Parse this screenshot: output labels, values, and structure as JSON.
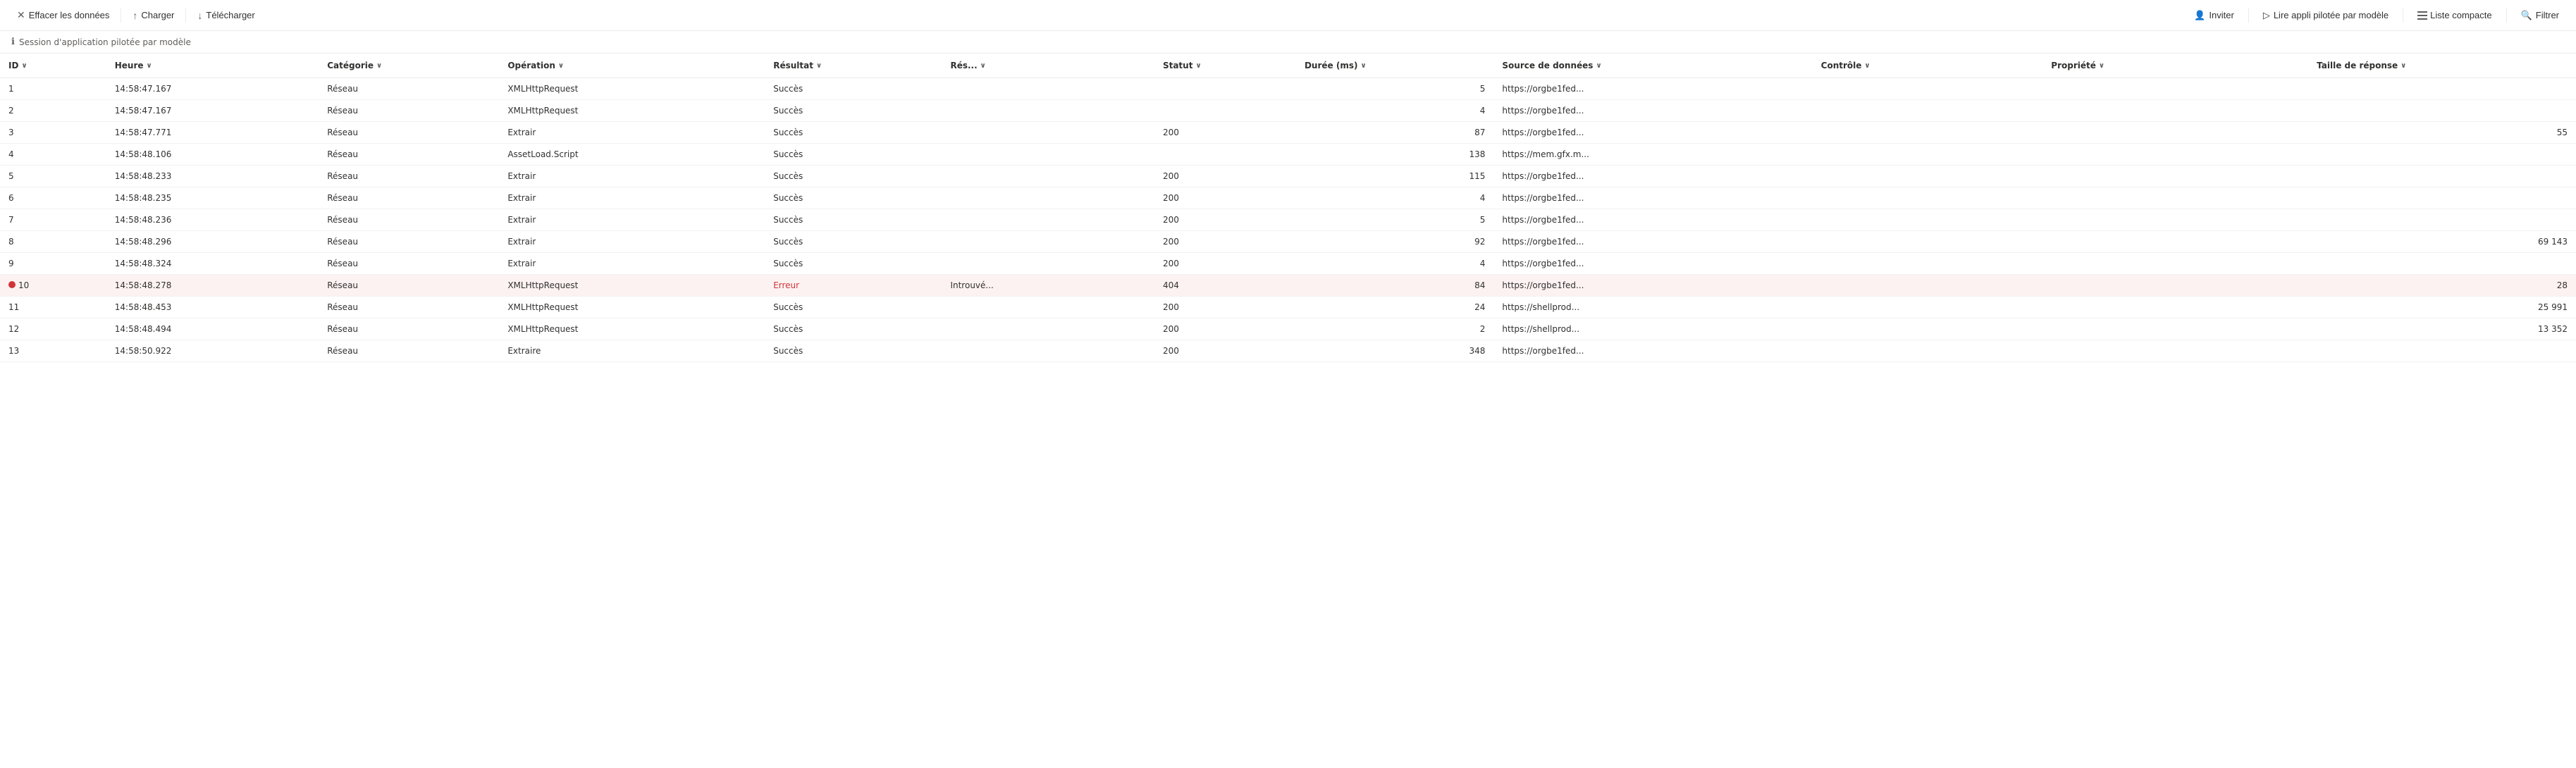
{
  "toolbar": {
    "clear_label": "Effacer les données",
    "load_label": "Charger",
    "download_label": "Télécharger",
    "invite_label": "Inviter",
    "read_app_label": "Lire appli pilotée par modèle",
    "liste_compacte_label": "Liste compacte",
    "filter_label": "Filtrer"
  },
  "session_bar": {
    "text": "Session d'application pilotée par modèle"
  },
  "table": {
    "columns": [
      {
        "id": "id",
        "label": "ID",
        "sortable": true
      },
      {
        "id": "heure",
        "label": "Heure",
        "sortable": true
      },
      {
        "id": "categorie",
        "label": "Catégorie",
        "sortable": true
      },
      {
        "id": "operation",
        "label": "Opération",
        "sortable": true
      },
      {
        "id": "resultat",
        "label": "Résultat",
        "sortable": true
      },
      {
        "id": "res",
        "label": "Rés...",
        "sortable": true
      },
      {
        "id": "statut",
        "label": "Statut",
        "sortable": true
      },
      {
        "id": "duree",
        "label": "Durée (ms)",
        "sortable": true
      },
      {
        "id": "source",
        "label": "Source de données",
        "sortable": true
      },
      {
        "id": "controle",
        "label": "Contrôle",
        "sortable": true
      },
      {
        "id": "propriete",
        "label": "Propriété",
        "sortable": true
      },
      {
        "id": "taille",
        "label": "Taille de réponse",
        "sortable": true
      }
    ],
    "rows": [
      {
        "id": 1,
        "heure": "14:58:47.167",
        "categorie": "Réseau",
        "operation": "XMLHttpRequest",
        "resultat": "Succès",
        "res": "",
        "statut": "",
        "duree": 5,
        "source": "https://orgbe1fed...",
        "controle": "",
        "propriete": "",
        "taille": "",
        "error": false
      },
      {
        "id": 2,
        "heure": "14:58:47.167",
        "categorie": "Réseau",
        "operation": "XMLHttpRequest",
        "resultat": "Succès",
        "res": "",
        "statut": "",
        "duree": 4,
        "source": "https://orgbe1fed...",
        "controle": "",
        "propriete": "",
        "taille": "",
        "error": false
      },
      {
        "id": 3,
        "heure": "14:58:47.771",
        "categorie": "Réseau",
        "operation": "Extrair",
        "resultat": "Succès",
        "res": "",
        "statut": 200,
        "duree": 87,
        "source": "https://orgbe1fed...",
        "controle": "",
        "propriete": "",
        "taille": 55,
        "error": false
      },
      {
        "id": 4,
        "heure": "14:58:48.106",
        "categorie": "Réseau",
        "operation": "AssetLoad.Script",
        "resultat": "Succès",
        "res": "",
        "statut": "",
        "duree": 138,
        "source": "https://mem.gfx.m...",
        "controle": "",
        "propriete": "",
        "taille": "",
        "error": false
      },
      {
        "id": 5,
        "heure": "14:58:48.233",
        "categorie": "Réseau",
        "operation": "Extrair",
        "resultat": "Succès",
        "res": "",
        "statut": 200,
        "duree": 115,
        "source": "https://orgbe1fed...",
        "controle": "",
        "propriete": "",
        "taille": "",
        "error": false
      },
      {
        "id": 6,
        "heure": "14:58:48.235",
        "categorie": "Réseau",
        "operation": "Extrair",
        "resultat": "Succès",
        "res": "",
        "statut": 200,
        "duree": 4,
        "source": "https://orgbe1fed...",
        "controle": "",
        "propriete": "",
        "taille": "",
        "error": false
      },
      {
        "id": 7,
        "heure": "14:58:48.236",
        "categorie": "Réseau",
        "operation": "Extrair",
        "resultat": "Succès",
        "res": "",
        "statut": 200,
        "duree": 5,
        "source": "https://orgbe1fed...",
        "controle": "",
        "propriete": "",
        "taille": "",
        "error": false
      },
      {
        "id": 8,
        "heure": "14:58:48.296",
        "categorie": "Réseau",
        "operation": "Extrair",
        "resultat": "Succès",
        "res": "",
        "statut": 200,
        "duree": 92,
        "source": "https://orgbe1fed...",
        "controle": "",
        "propriete": "",
        "taille": "69 143",
        "error": false
      },
      {
        "id": 9,
        "heure": "14:58:48.324",
        "categorie": "Réseau",
        "operation": "Extrair",
        "resultat": "Succès",
        "res": "",
        "statut": 200,
        "duree": 4,
        "source": "https://orgbe1fed...",
        "controle": "",
        "propriete": "",
        "taille": "",
        "error": false
      },
      {
        "id": 10,
        "heure": "14:58:48.278",
        "categorie": "Réseau",
        "operation": "XMLHttpRequest",
        "resultat": "Erreur",
        "res": "Introuvé...",
        "statut": 404,
        "duree": 84,
        "source": "https://orgbe1fed...",
        "controle": "",
        "propriete": "",
        "taille": 28,
        "error": true
      },
      {
        "id": 11,
        "heure": "14:58:48.453",
        "categorie": "Réseau",
        "operation": "XMLHttpRequest",
        "resultat": "Succès",
        "res": "",
        "statut": 200,
        "duree": 24,
        "source": "https://shellprod...",
        "controle": "",
        "propriete": "",
        "taille": "25 991",
        "error": false
      },
      {
        "id": 12,
        "heure": "14:58:48.494",
        "categorie": "Réseau",
        "operation": "XMLHttpRequest",
        "resultat": "Succès",
        "res": "",
        "statut": 200,
        "duree": 2,
        "source": "https://shellprod...",
        "controle": "",
        "propriete": "",
        "taille": "13 352",
        "error": false
      },
      {
        "id": 13,
        "heure": "14:58:50.922",
        "categorie": "Réseau",
        "operation": "Extraire",
        "resultat": "Succès",
        "res": "",
        "statut": 200,
        "duree": 348,
        "source": "https://orgbe1fed...",
        "controle": "",
        "propriete": "",
        "taille": "",
        "error": false
      }
    ]
  }
}
